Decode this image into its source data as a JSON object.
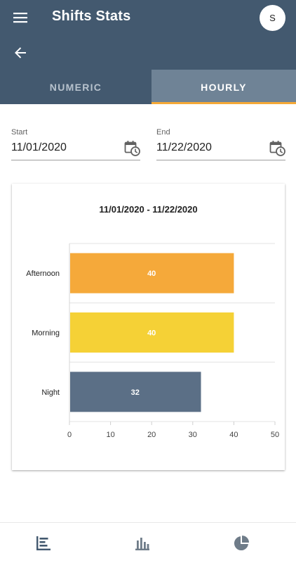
{
  "header": {
    "title": "Shifts Stats",
    "avatar_initial": "S",
    "icons": {
      "menu": "menu-icon",
      "back": "arrow-back-icon"
    }
  },
  "tabs": [
    {
      "label": "NUMERIC",
      "active": false
    },
    {
      "label": "HOURLY",
      "active": true
    }
  ],
  "filters": {
    "start": {
      "label": "Start",
      "value": "11/01/2020",
      "icon": "calendar-clock-icon"
    },
    "end": {
      "label": "End",
      "value": "11/22/2020",
      "icon": "calendar-clock-icon"
    }
  },
  "chart_data": {
    "type": "bar",
    "orientation": "horizontal",
    "title": "11/01/2020 - 11/22/2020",
    "categories": [
      "Afternoon",
      "Morning",
      "Night"
    ],
    "values": [
      40,
      40,
      32
    ],
    "colors": [
      "#f5a93a",
      "#f5d136",
      "#5b6f86"
    ],
    "xlim": [
      0,
      50
    ],
    "xticks": [
      0,
      10,
      20,
      30,
      40,
      50
    ],
    "grid": true,
    "data_labels": true
  },
  "bottom_nav": [
    {
      "icon": "horizontal-bar-chart-icon",
      "active": true
    },
    {
      "icon": "vertical-bar-chart-icon",
      "active": false
    },
    {
      "icon": "pie-chart-icon",
      "active": false
    }
  ],
  "colors": {
    "header": "#43596f",
    "active_tab": "#6f8396",
    "tab_indicator": "#f5a937"
  }
}
